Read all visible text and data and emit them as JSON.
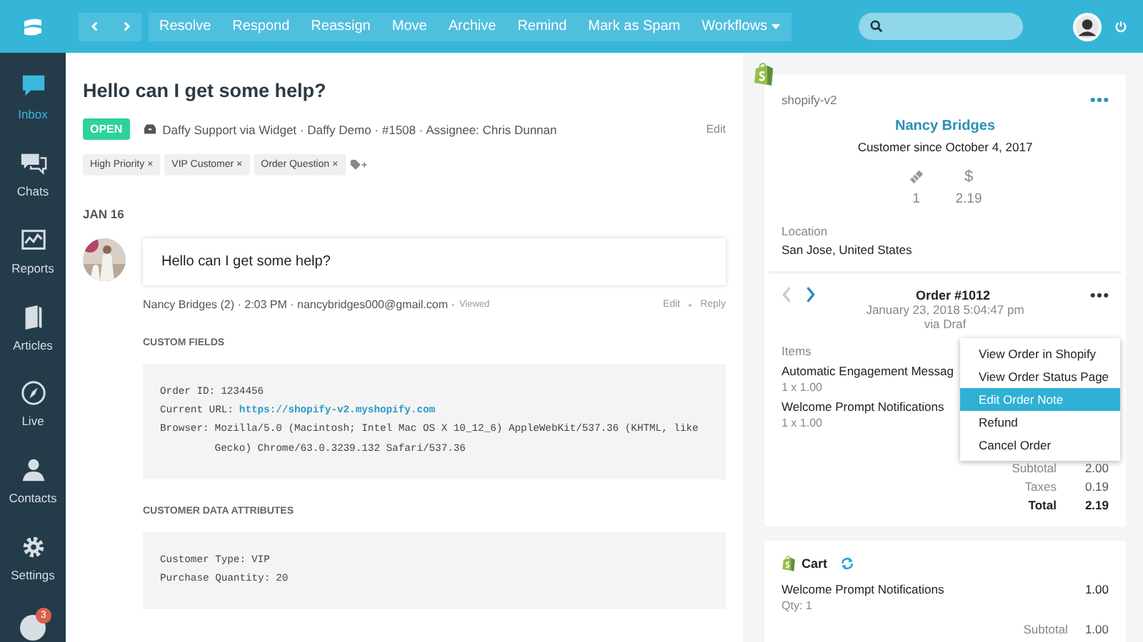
{
  "toolbar": {
    "actions": [
      {
        "label": "Resolve",
        "kind": "button"
      },
      {
        "label": "Respond",
        "kind": "button"
      },
      {
        "label": "Reassign",
        "kind": "button"
      },
      {
        "label": "Move",
        "kind": "button"
      },
      {
        "label": "Archive",
        "kind": "button"
      },
      {
        "label": "Remind",
        "kind": "button"
      },
      {
        "label": "Mark as Spam",
        "kind": "button"
      },
      {
        "label": "Workflows",
        "kind": "dropdown"
      }
    ]
  },
  "sidebar": {
    "items": [
      {
        "kind": "inbox",
        "label": "Inbox",
        "selected": true
      },
      {
        "kind": "chats",
        "label": "Chats",
        "selected": false
      },
      {
        "kind": "reports",
        "label": "Reports",
        "selected": false
      },
      {
        "kind": "articles",
        "label": "Articles",
        "selected": false
      },
      {
        "kind": "live",
        "label": "Live",
        "selected": false
      },
      {
        "kind": "contacts",
        "label": "Contacts",
        "selected": false
      },
      {
        "kind": "settings",
        "label": "Settings",
        "selected": false
      }
    ],
    "help_badge": "3"
  },
  "conversation": {
    "title": "Hello can I get some help?",
    "status": "OPEN",
    "meta": "Daffy Support via Widget · Daffy Demo · #1508 · Assignee: Chris Dunnan",
    "edit": "Edit",
    "tags": [
      "High Priority ×",
      "VIP Customer ×",
      "Order Question ×"
    ],
    "date": "JAN 16",
    "message": {
      "text": "Hello can I get some help?",
      "author": "Nancy Bridges (2) · 2:03 PM · nancybridges000@gmail.com ·",
      "viewed": "Viewed",
      "actions": [
        "Edit",
        "Reply"
      ]
    },
    "sections": [
      {
        "heading": "CUSTOM FIELDS",
        "lines": [
          {
            "label": "Order ID:",
            "value": "1234456",
            "kind": "text"
          },
          {
            "label": "Current URL:",
            "value": "https://shopify-v2.myshopify.com",
            "kind": "link"
          },
          {
            "label": "Browser:",
            "value": "Mozilla/5.0 (Macintosh; Intel Mac OS X 10_12_6) AppleWebKit/537.36 (KHTML, like Gecko) Chrome/63.0.3239.132 Safari/537.36",
            "kind": "text"
          }
        ]
      },
      {
        "heading": "CUSTOMER DATA ATTRIBUTES",
        "lines": [
          {
            "label": "Customer Type:",
            "value": "VIP",
            "kind": "text"
          },
          {
            "label": "Purchase Quantity:",
            "value": "20",
            "kind": "text"
          }
        ]
      }
    ]
  },
  "customer": {
    "source": "shopify-v2",
    "name": "Nancy Bridges",
    "since": "Customer since October 4, 2017",
    "stats": [
      {
        "kind": "orders",
        "value": "1"
      },
      {
        "kind": "spent",
        "symbol": "$",
        "value": "2.19"
      }
    ],
    "location_label": "Location",
    "location": "San Jose, United States"
  },
  "order": {
    "title": "Order #1012",
    "prev_disabled": true,
    "date": "January 23, 2018 5:04:47 pm",
    "via": "via Draf",
    "items_label": "Items",
    "items": [
      {
        "name": "Automatic Engagement Messag",
        "qty": "1 x 1.00"
      },
      {
        "name": "Welcome Prompt Notifications",
        "qty": "1 x 1.00"
      }
    ],
    "totals": [
      {
        "label": "Subtotal",
        "value": "2.00",
        "kind": "normal"
      },
      {
        "label": "Taxes",
        "value": "0.19",
        "kind": "normal"
      },
      {
        "label": "Total",
        "value": "2.19",
        "kind": "total"
      }
    ],
    "menu": [
      {
        "label": "View Order in Shopify",
        "selected": false
      },
      {
        "label": "View Order Status Page",
        "selected": false
      },
      {
        "label": "Edit Order Note",
        "selected": true
      },
      {
        "label": "Refund",
        "selected": false
      },
      {
        "label": "Cancel Order",
        "selected": false
      }
    ]
  },
  "cart": {
    "title": "Cart",
    "items": [
      {
        "name": "Welcome Prompt Notifications",
        "qty": "Qty: 1",
        "price": "1.00"
      }
    ],
    "subtotal_label": "Subtotal",
    "subtotal": "1.00"
  }
}
